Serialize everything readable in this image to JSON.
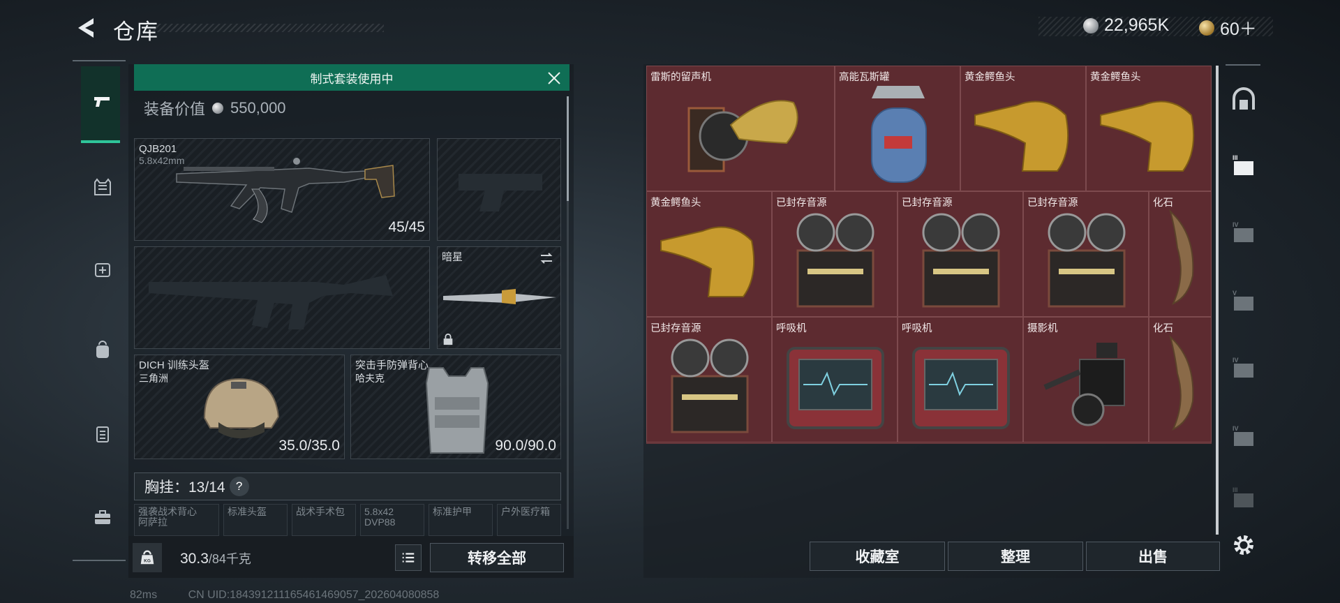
{
  "header": {
    "title": "仓库"
  },
  "currency": {
    "silver": "22,965K",
    "gold": "60＋"
  },
  "loadout": {
    "kit_banner": "制式套装使用中",
    "equip_value_label": "装备价值",
    "equip_value": "550,000",
    "primary": {
      "name": "QJB201",
      "ammo": "5.8x42mm",
      "count": "45/45"
    },
    "melee": {
      "name": "暗星"
    },
    "helmet": {
      "name": "DICH 训练头盔",
      "maker": "三角洲",
      "durability": "35.0/35.0"
    },
    "armor": {
      "name": "突击手防弹背心",
      "maker": "哈夫克",
      "durability": "90.0/90.0"
    },
    "rig_label": "胸挂：13/14",
    "help": "?",
    "mini_slots": [
      {
        "line1": "强袭战术背心",
        "line2": "阿萨拉"
      },
      {
        "line1": "标准头盔",
        "line2": ""
      },
      {
        "line1": "战术手术包",
        "line2": ""
      },
      {
        "line1": "5.8x42",
        "line2": "DVP88"
      },
      {
        "line1": "标准护甲",
        "line2": ""
      },
      {
        "line1": "户外医疗箱",
        "line2": ""
      }
    ],
    "weight_value": "30.3",
    "weight_max": "/84千克",
    "kg_label": "KG",
    "transfer_all": "转移全部"
  },
  "stash": {
    "items": [
      {
        "label": "雷斯的留声机",
        "icon": "gramophone"
      },
      {
        "label": "高能瓦斯罐",
        "icon": "gas-canister"
      },
      {
        "label": "黄金鳄鱼头",
        "icon": "gold-croc-head"
      },
      {
        "label": "黄金鳄鱼头",
        "icon": "gold-croc-head"
      },
      {
        "label": "黄金鳄鱼头",
        "icon": "gold-croc-head"
      },
      {
        "label": "已封存音源",
        "icon": "reel-recorder"
      },
      {
        "label": "已封存音源",
        "icon": "reel-recorder"
      },
      {
        "label": "已封存音源",
        "icon": "reel-recorder"
      },
      {
        "label": "化石",
        "icon": "fossil"
      },
      {
        "label": "已封存音源",
        "icon": "reel-recorder"
      },
      {
        "label": "呼吸机",
        "icon": "ventilator"
      },
      {
        "label": "呼吸机",
        "icon": "ventilator"
      },
      {
        "label": "摄影机",
        "icon": "camera"
      },
      {
        "label": "化石",
        "icon": "fossil"
      }
    ],
    "buttons": {
      "collection": "收藏室",
      "sort": "整理",
      "sell": "出售"
    },
    "tiers": [
      "III",
      "IV",
      "V",
      "IV",
      "IV",
      "III"
    ]
  },
  "status": {
    "ping": "82ms",
    "uid": "CN UID:184391211165461469057_202604080858"
  },
  "colors": {
    "accent": "#2fc499",
    "banner": "#0f6e55",
    "stash_bg": "#5d2b30"
  }
}
